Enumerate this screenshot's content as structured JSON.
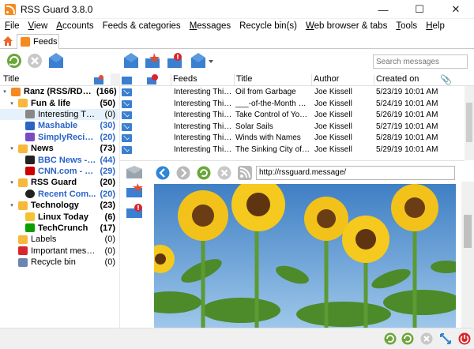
{
  "window": {
    "title": "RSS Guard 3.8.0",
    "controls": [
      "—",
      "☐",
      "✕"
    ]
  },
  "menu": [
    {
      "label": "File",
      "ul": "F",
      "rest": "ile"
    },
    {
      "label": "View",
      "ul": "V",
      "rest": "iew"
    },
    {
      "label": "Accounts",
      "ul": "A",
      "rest": "ccounts"
    },
    {
      "label": "Feeds & categories",
      "ul": "",
      "rest": "Feeds & categories"
    },
    {
      "label": "Messages",
      "ul": "M",
      "rest": "essages"
    },
    {
      "label": "Recycle bin(s)",
      "ul": "",
      "rest": "Recycle bin(s)"
    },
    {
      "label": "Web browser & tabs",
      "ul": "W",
      "rest": "eb browser & tabs"
    },
    {
      "label": "Tools",
      "ul": "T",
      "rest": "ools"
    },
    {
      "label": "Help",
      "ul": "H",
      "rest": "elp"
    }
  ],
  "tabs": {
    "feeds_label": "Feeds"
  },
  "search": {
    "placeholder": "Search messages"
  },
  "tree": {
    "header_title": "Title",
    "rows": [
      {
        "label": "Ranz (RSS/RDF/...",
        "count": "(166)",
        "style": "bold",
        "indent": 0,
        "arrow": "▾",
        "icon": "rss-account-icon"
      },
      {
        "label": "Fun & life",
        "count": "(50)",
        "style": "bold",
        "indent": 1,
        "arrow": "▾",
        "icon": "folder-icon"
      },
      {
        "label": "Interesting Thin...",
        "count": "(0)",
        "style": "normal",
        "indent": 2,
        "arrow": "",
        "icon": "feed-icon",
        "selected": true
      },
      {
        "label": "Mashable",
        "count": "(30)",
        "style": "blue",
        "indent": 2,
        "arrow": "",
        "icon": "mashable-icon"
      },
      {
        "label": "SimplyRecipe...",
        "count": "(20)",
        "style": "blue",
        "indent": 2,
        "arrow": "",
        "icon": "recipe-icon"
      },
      {
        "label": "News",
        "count": "(73)",
        "style": "bold",
        "indent": 1,
        "arrow": "▾",
        "icon": "folder-icon"
      },
      {
        "label": "BBC News - H...",
        "count": "(44)",
        "style": "blue",
        "indent": 2,
        "arrow": "",
        "icon": "bbc-icon"
      },
      {
        "label": "CNN.com - W...",
        "count": "(29)",
        "style": "blue",
        "indent": 2,
        "arrow": "",
        "icon": "cnn-icon"
      },
      {
        "label": "RSS Guard",
        "count": "(20)",
        "style": "bold",
        "indent": 1,
        "arrow": "▾",
        "icon": "folder-icon"
      },
      {
        "label": "Recent Com...",
        "count": "(20)",
        "style": "blue",
        "indent": 2,
        "arrow": "",
        "icon": "github-icon"
      },
      {
        "label": "Technology",
        "count": "(23)",
        "style": "bold",
        "indent": 1,
        "arrow": "▾",
        "icon": "folder-icon"
      },
      {
        "label": "Linux Today",
        "count": "(6)",
        "style": "bold",
        "indent": 2,
        "arrow": "",
        "icon": "linux-icon"
      },
      {
        "label": "TechCrunch",
        "count": "(17)",
        "style": "bold",
        "indent": 2,
        "arrow": "",
        "icon": "techcrunch-icon"
      },
      {
        "label": "Labels",
        "count": "(0)",
        "style": "normal",
        "indent": 1,
        "arrow": "",
        "icon": "labels-icon"
      },
      {
        "label": "Important messages",
        "count": "(0)",
        "style": "normal",
        "indent": 1,
        "arrow": "",
        "icon": "important-icon"
      },
      {
        "label": "Recycle bin",
        "count": "(0)",
        "style": "normal",
        "indent": 1,
        "arrow": "",
        "icon": "recycle-bin-icon"
      }
    ]
  },
  "messages": {
    "headers": {
      "feeds": "Feeds",
      "title": "Title",
      "author": "Author",
      "created": "Created on"
    },
    "rows": [
      {
        "feed": "Interesting Thing...",
        "title": "Oil from Garbage",
        "author": "Joe Kissell",
        "created": "5/23/19 10:01 AM"
      },
      {
        "feed": "Interesting Thing...",
        "title": "___-of-the-Month Clubs",
        "author": "Joe Kissell",
        "created": "5/24/19 10:01 AM"
      },
      {
        "feed": "Interesting Thing...",
        "title": "Take Control of Your D...",
        "author": "Joe Kissell",
        "created": "5/26/19 10:01 AM"
      },
      {
        "feed": "Interesting Thing...",
        "title": "Solar Sails",
        "author": "Joe Kissell",
        "created": "5/27/19 10:01 AM"
      },
      {
        "feed": "Interesting Thing...",
        "title": "Winds with Names",
        "author": "Joe Kissell",
        "created": "5/28/19 10:01 AM"
      },
      {
        "feed": "Interesting Thing...",
        "title": "The Sinking City of Ve...",
        "author": "Joe Kissell",
        "created": "5/29/19 10:01 AM"
      }
    ]
  },
  "viewer": {
    "url": "http://rssguard.message/"
  }
}
